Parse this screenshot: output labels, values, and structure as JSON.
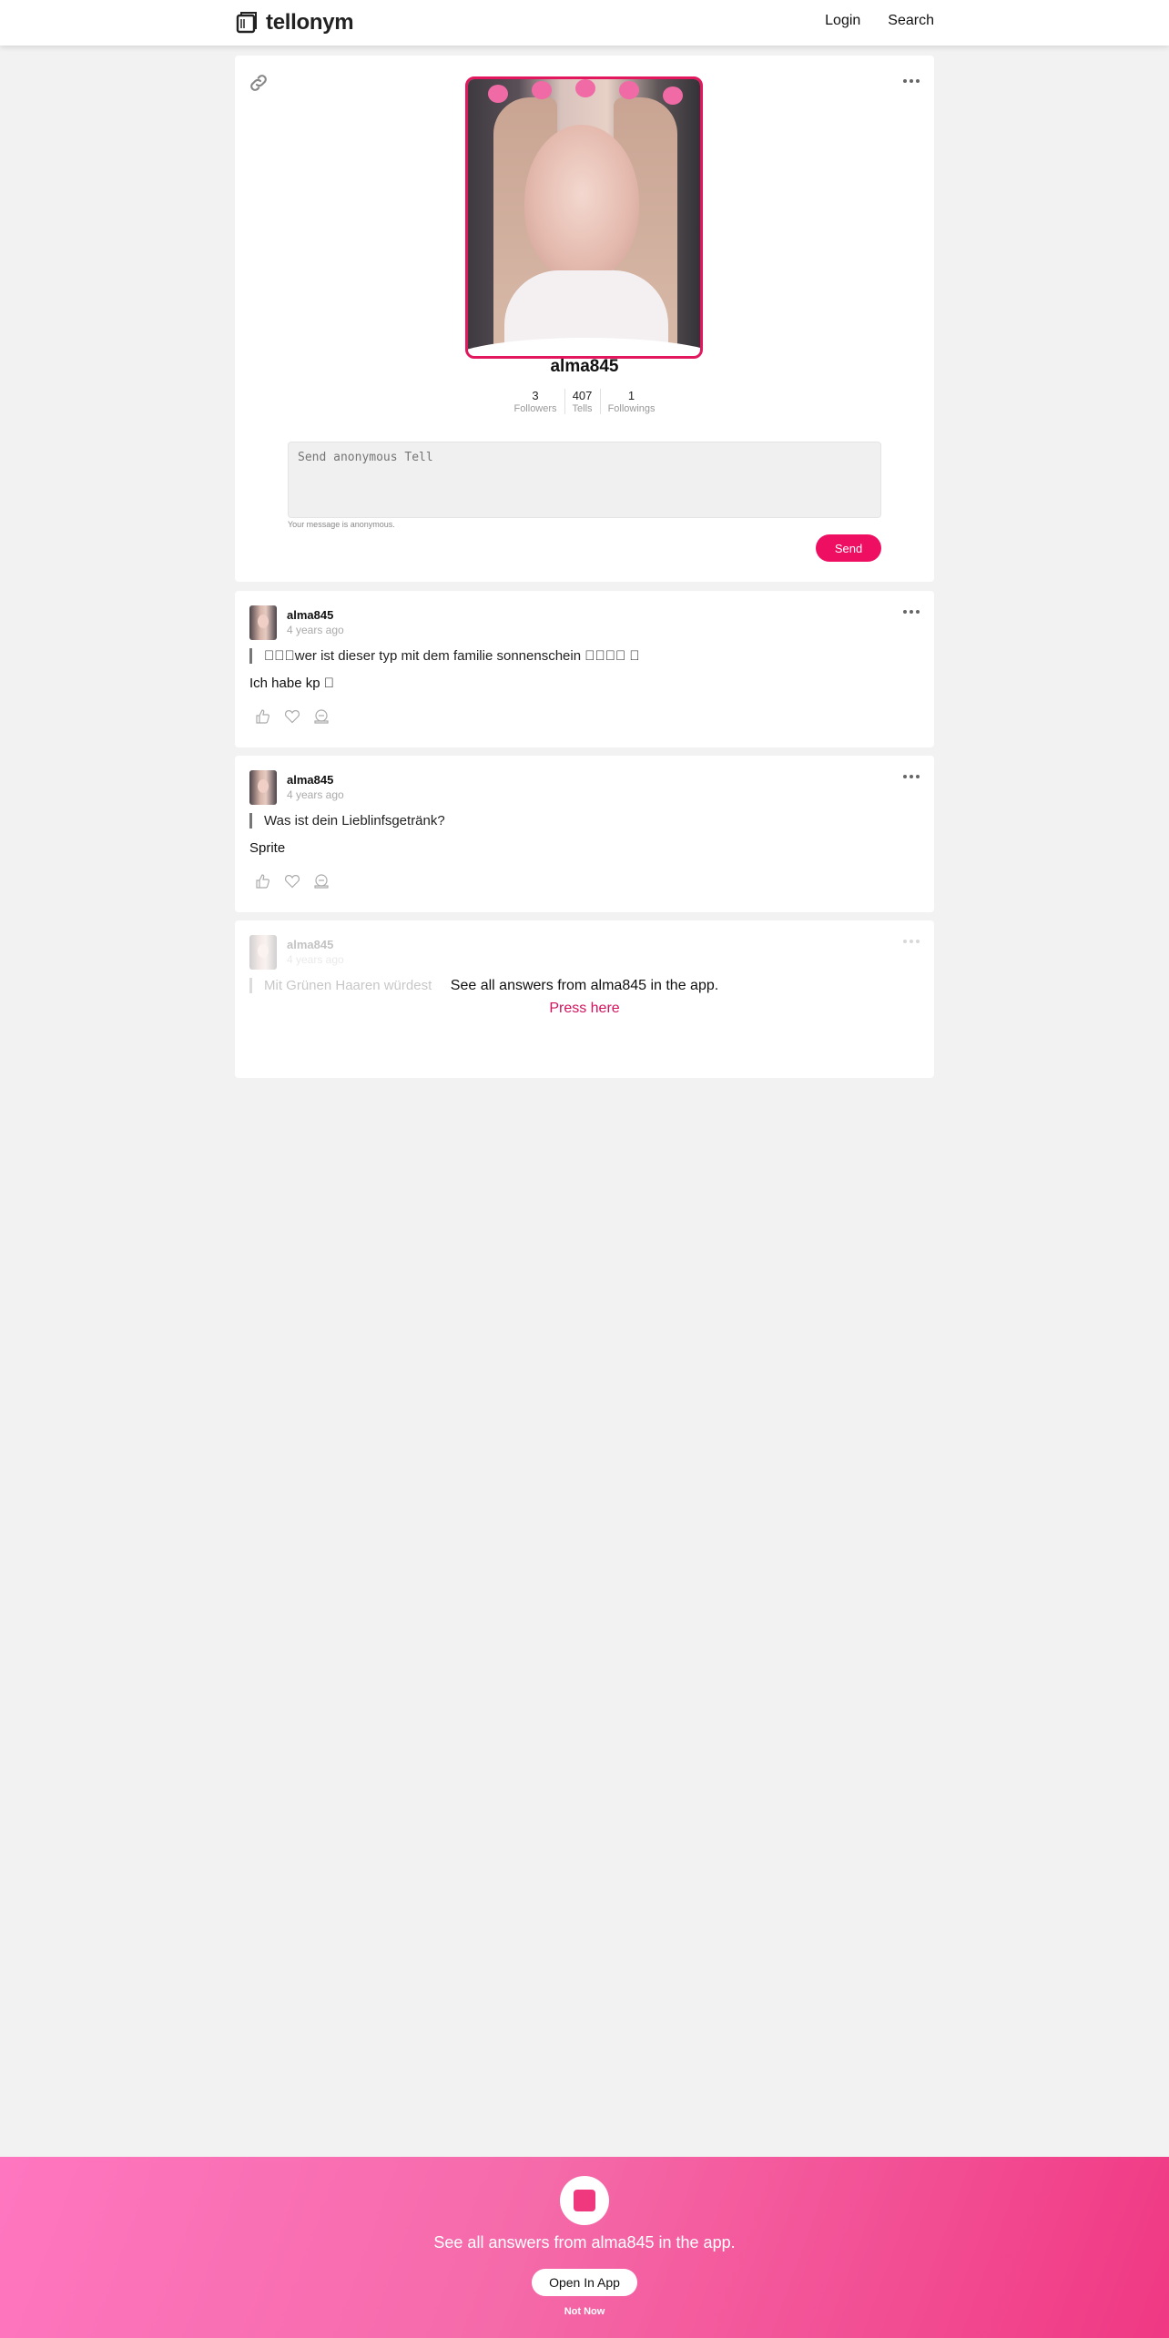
{
  "header": {
    "brand": "tellonym",
    "nav": {
      "login": "Login",
      "search": "Search"
    }
  },
  "profile": {
    "username": "alma845",
    "stats": [
      {
        "value": "3",
        "label": "Followers"
      },
      {
        "value": "407",
        "label": "Tells"
      },
      {
        "value": "1",
        "label": "Followings"
      }
    ],
    "tell_placeholder": "Send anonymous Tell",
    "anonymous_note": "Your message is anonymous.",
    "send_label": "Send",
    "accent_color": "#e3175e"
  },
  "tells": [
    {
      "user": "alma845",
      "time": "4 years ago",
      "question": "\u0000\u0000\u0000wer ist dieser typ mit dem familie sonnenschein \u0000\u0000\u0000\u0000 \u0000",
      "answer": "Ich habe kp \u0000"
    },
    {
      "user": "alma845",
      "time": "4 years ago",
      "question": "Was ist dein Lieblinfsgetränk?",
      "answer": "Sprite"
    }
  ],
  "locked_tell": {
    "user": "alma845",
    "time": "4 years ago",
    "question": "Mit Grünen Haaren würdest",
    "message": "See all answers from alma845 in the app.",
    "link": "Press here"
  },
  "banner": {
    "text": "See all answers from alma845 in the app.",
    "open_label": "Open In App",
    "dismiss_label": "Not Now",
    "gradient_start": "#ff76c0",
    "gradient_end": "#f03883"
  }
}
